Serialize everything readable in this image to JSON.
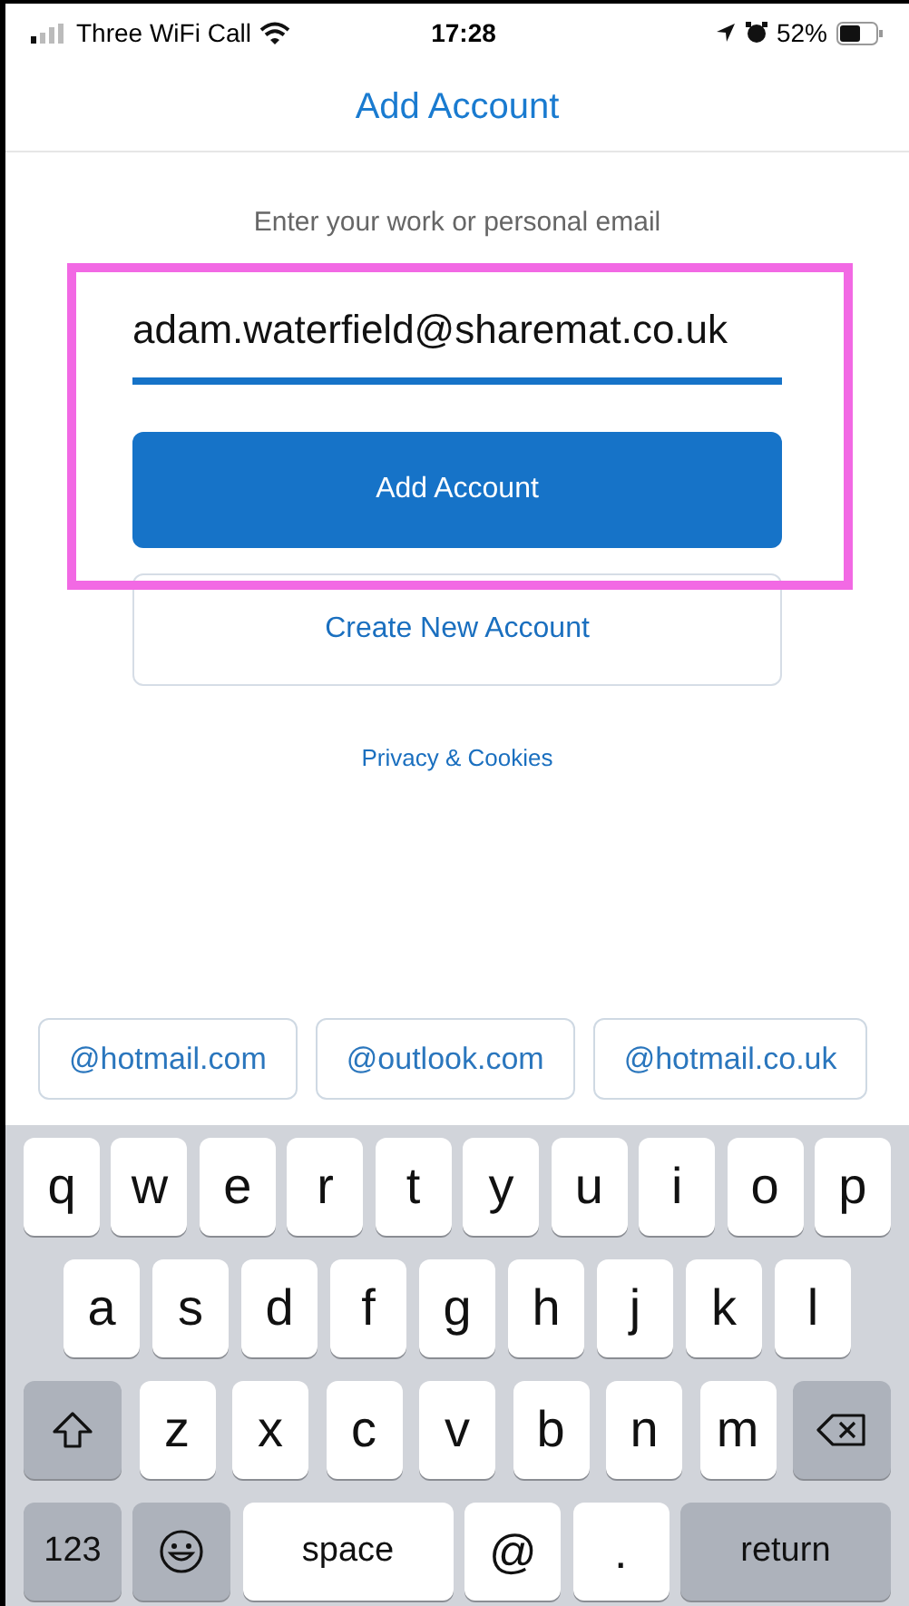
{
  "status_bar": {
    "carrier": "Three WiFi Call",
    "time": "17:28",
    "battery": "52%"
  },
  "nav": {
    "title": "Add Account"
  },
  "form": {
    "prompt": "Enter your work or personal email",
    "email": {
      "value": "adam.waterfield@sharemat.co.uk"
    },
    "primary_button": "Add Account",
    "secondary_button": "Create New Account",
    "link": "Privacy & Cookies",
    "highlighted": true
  },
  "suggestions": [
    "@hotmail.com",
    "@outlook.com",
    "@hotmail.co.uk"
  ],
  "keyboard": {
    "rows": [
      {
        "keys": [
          {
            "kind": "letter",
            "label": "q"
          },
          {
            "kind": "letter",
            "label": "w"
          },
          {
            "kind": "letter",
            "label": "e"
          },
          {
            "kind": "letter",
            "label": "r"
          },
          {
            "kind": "letter",
            "label": "t"
          },
          {
            "kind": "letter",
            "label": "y"
          },
          {
            "kind": "letter",
            "label": "u"
          },
          {
            "kind": "letter",
            "label": "i"
          },
          {
            "kind": "letter",
            "label": "o"
          },
          {
            "kind": "letter",
            "label": "p"
          }
        ]
      },
      {
        "keys": [
          {
            "kind": "letter",
            "label": "a"
          },
          {
            "kind": "letter",
            "label": "s"
          },
          {
            "kind": "letter",
            "label": "d"
          },
          {
            "kind": "letter",
            "label": "f"
          },
          {
            "kind": "letter",
            "label": "g"
          },
          {
            "kind": "letter",
            "label": "h"
          },
          {
            "kind": "letter",
            "label": "j"
          },
          {
            "kind": "letter",
            "label": "k"
          },
          {
            "kind": "letter",
            "label": "l"
          }
        ]
      },
      {
        "keys": [
          {
            "kind": "shift"
          },
          {
            "kind": "letter",
            "label": "z"
          },
          {
            "kind": "letter",
            "label": "x"
          },
          {
            "kind": "letter",
            "label": "c"
          },
          {
            "kind": "letter",
            "label": "v"
          },
          {
            "kind": "letter",
            "label": "b"
          },
          {
            "kind": "letter",
            "label": "n"
          },
          {
            "kind": "letter",
            "label": "m"
          },
          {
            "kind": "delete"
          }
        ]
      },
      {
        "keys": [
          {
            "kind": "numbers",
            "label": "123"
          },
          {
            "kind": "emoji"
          },
          {
            "kind": "space",
            "label": "space"
          },
          {
            "kind": "symbol",
            "label": "@"
          },
          {
            "kind": "symbol",
            "label": "."
          },
          {
            "kind": "return",
            "label": "return"
          }
        ]
      }
    ]
  }
}
